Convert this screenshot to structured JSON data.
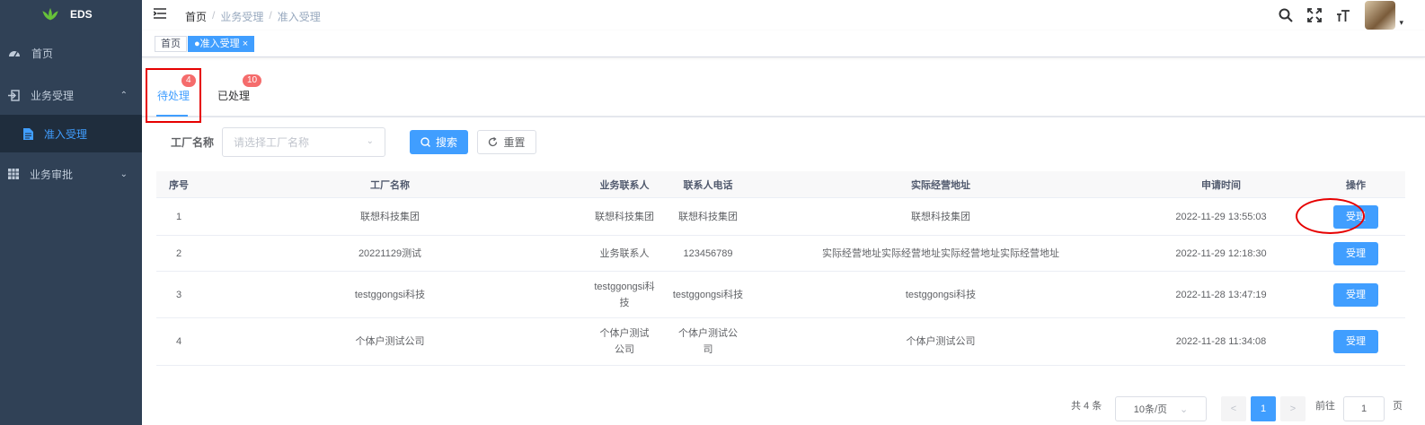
{
  "app": {
    "logo_text": "EDS"
  },
  "sidebar": {
    "items": [
      {
        "label": "首页"
      },
      {
        "label": "业务受理",
        "expanded": true,
        "children": [
          {
            "label": "准入受理",
            "active": true
          }
        ]
      },
      {
        "label": "业务审批"
      }
    ]
  },
  "breadcrumb": {
    "home": "首页",
    "level1": "业务受理",
    "level2": "准入受理",
    "sep": "/"
  },
  "tags": {
    "home": "首页",
    "active": "●准入受理",
    "close": "×"
  },
  "tabs": [
    {
      "label": "待处理",
      "badge": "4",
      "active": true
    },
    {
      "label": "已处理",
      "badge": "10"
    }
  ],
  "filter": {
    "factory_label": "工厂名称",
    "factory_placeholder": "请选择工厂名称",
    "search_label": "搜索",
    "reset_label": "重置"
  },
  "table": {
    "headers": [
      "序号",
      "工厂名称",
      "业务联系人",
      "联系人电话",
      "实际经营地址",
      "申请时间",
      "操作"
    ],
    "rows": [
      {
        "no": "1",
        "factory": "联想科技集团",
        "contact": "联想科技集团",
        "phone": "联想科技集团",
        "address": "联想科技集团",
        "time": "2022-11-29 13:55:03",
        "action": "受理"
      },
      {
        "no": "2",
        "factory": "20221129测试",
        "contact": "业务联系人",
        "phone": "123456789",
        "address": "实际经营地址实际经营地址实际经营地址实际经营地址",
        "time": "2022-11-29 12:18:30",
        "action": "受理"
      },
      {
        "no": "3",
        "factory": "testggongsi科技",
        "contact": "testggongsi科技",
        "phone": "testggongsi科技",
        "address": "testggongsi科技",
        "time": "2022-11-28 13:47:19",
        "action": "受理"
      },
      {
        "no": "4",
        "factory": "个体户测试公司",
        "contact": "个体户测试公司",
        "phone": "个体户测试公司",
        "address": "个体户测试公司",
        "time": "2022-11-28 11:34:08",
        "action": "受理"
      }
    ]
  },
  "pagination": {
    "total": "共 4 条",
    "page_size": "10条/页",
    "prev": "<",
    "current": "1",
    "next": ">",
    "goto_label": "前往",
    "goto_value": "1",
    "page_unit": "页"
  },
  "colors": {
    "sidebar_bg": "#304156",
    "accent": "#409eff",
    "badge": "#f56c6c",
    "annotation": "#e60000"
  }
}
